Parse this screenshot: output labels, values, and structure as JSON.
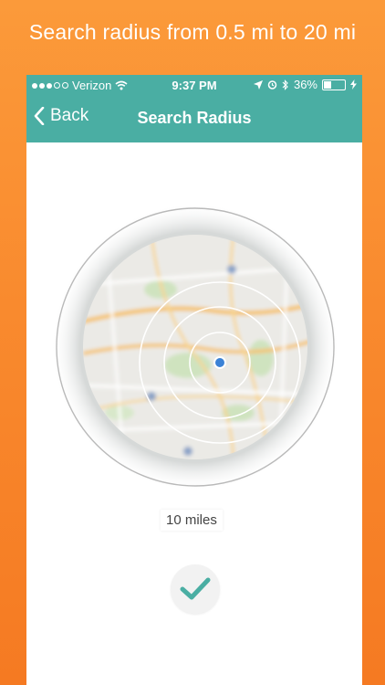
{
  "caption": "Search radius from 0.5 mi to 20 mi",
  "status_bar": {
    "carrier": "Verizon",
    "time": "9:37 PM",
    "battery": "36%",
    "battery_level": 0.36
  },
  "nav": {
    "back_label": "Back",
    "title": "Search Radius"
  },
  "radius_label": "10 miles",
  "colors": {
    "background_top": "#fb9a3a",
    "background_bottom": "#f57a22",
    "header": "#4aaea3",
    "accent": "#4aaea3",
    "location_dot": "#3b82d6"
  },
  "icons": {
    "back": "chevron-left-icon",
    "wifi": "wifi-icon",
    "location": "location-arrow-icon",
    "alarm": "alarm-icon",
    "bluetooth": "bluetooth-icon",
    "charging": "bolt-icon",
    "confirm": "checkmark-icon"
  }
}
